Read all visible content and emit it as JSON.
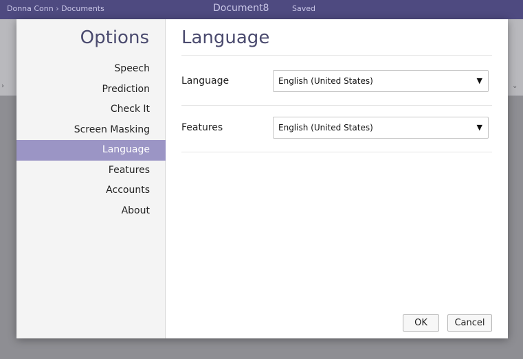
{
  "background_app": {
    "breadcrumb": "Donna Conn › Documents",
    "document_title": "Document8",
    "save_status": "Saved"
  },
  "options": {
    "title": "Options",
    "nav_items": [
      "Speech",
      "Prediction",
      "Check It",
      "Screen Masking",
      "Language",
      "Features",
      "Accounts",
      "About"
    ],
    "active_item": "Language"
  },
  "main": {
    "title": "Language",
    "rows": [
      {
        "label": "Language",
        "value": "English (United States)"
      },
      {
        "label": "Features",
        "value": "English (United States)"
      }
    ]
  },
  "buttons": {
    "ok_label": "OK",
    "cancel_label": "Cancel"
  },
  "colors": {
    "accent": "#9b95c5",
    "title": "#4a4a6e",
    "app_header": "#4e4a80"
  },
  "icons": {
    "dropdown": "triangle-down-icon"
  }
}
